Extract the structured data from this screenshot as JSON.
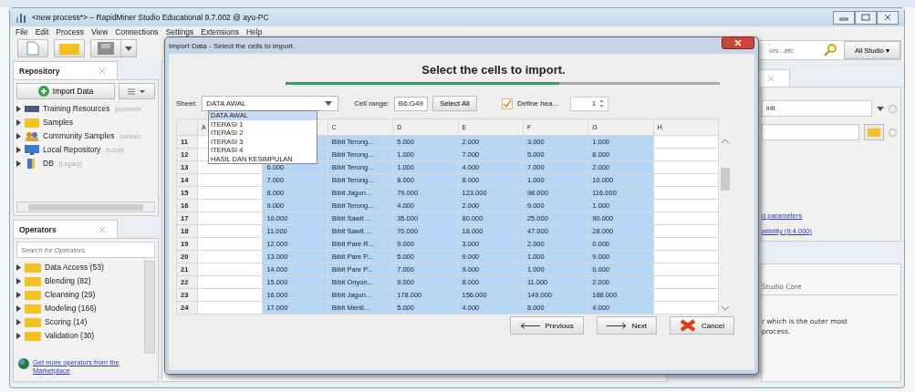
{
  "window": {
    "title": "<new process*> – RapidMiner Studio Educational 9.7.002 @ ayu-PC"
  },
  "menu": [
    "File",
    "Edit",
    "Process",
    "View",
    "Connections",
    "Settings",
    "Extensions",
    "Help"
  ],
  "repository": {
    "tab": "Repository",
    "import_button": "Import Data",
    "items": [
      {
        "label": "Training Resources",
        "note": "(connecte"
      },
      {
        "label": "Samples"
      },
      {
        "label": "Community Samples",
        "note": "(connec"
      },
      {
        "label": "Local Repository",
        "note": "(Local)"
      },
      {
        "label": "DB",
        "note": "(Legacy)"
      }
    ]
  },
  "operators": {
    "tab": "Operators",
    "search": {
      "placeholder": "Search for Operators"
    },
    "items": [
      "Data Access (53)",
      "Blending (82)",
      "Cleansing (29)",
      "Modeling (166)",
      "Scoring (14)",
      "Validation (30)"
    ],
    "marketplace_link": "Get more operators from the Marketplace"
  },
  "right_panel": {
    "search": {
      "value": "ors...etc"
    },
    "scope_button": "All Studio ▾",
    "select": "init",
    "links": [
      "d parameters",
      "atibility (9.4.000)"
    ],
    "help_title": "Studio Core",
    "help_text": [
      "r which is the outer most",
      "process."
    ]
  },
  "dialog": {
    "title": "Import Data - Select the cells to import.",
    "heading": "Select the cells to import.",
    "progress": {
      "level": 0.63
    },
    "sheet_label": "Sheet:",
    "sheet_value": "DATA AWAL",
    "sheet_options": [
      {
        "label": "DATA AWAL",
        "selected": true
      },
      {
        "label": "ITERASI 1",
        "selected": false
      },
      {
        "label": "ITERASI 2",
        "selected": false
      },
      {
        "label": "ITERASI 3",
        "selected": false
      },
      {
        "label": "ITERASI 4",
        "selected": false
      },
      {
        "label": "HASIL DAN KESIMPULAN",
        "selected": false
      }
    ],
    "cell_range_label": "Cell range:",
    "cell_range": "B6:G49",
    "select_all": "Select All",
    "define_header": {
      "label": "Define hea...",
      "checked": true
    },
    "header_row": "1",
    "columns": [
      {
        "name": "A",
        "selected": false
      },
      {
        "selected": true
      },
      {
        "name": "C",
        "selected": true
      },
      {
        "name": "D",
        "selected": true
      },
      {
        "name": "E",
        "selected": true
      },
      {
        "name": "F",
        "selected": true
      },
      {
        "name": "G",
        "selected": true
      },
      {
        "name": "H",
        "selected": false
      }
    ],
    "rows": [
      {
        "num": "11",
        "cells": [
          null,
          null,
          "Bibit Terong...",
          "5.000",
          "2.000",
          "3.000",
          "1.000",
          null
        ]
      },
      {
        "num": "12",
        "cells": [
          null,
          null,
          "Bibit Terong...",
          "1.000",
          "7.000",
          "5.000",
          "8.000",
          null
        ]
      },
      {
        "num": "13",
        "cells": [
          null,
          "6.000",
          "Bibit Terong...",
          "1.000",
          "4.000",
          "7.000",
          "2.000",
          null
        ]
      },
      {
        "num": "14",
        "cells": [
          null,
          "7.000",
          "Bibit Terong...",
          "8.000",
          "8.000",
          "1.000",
          "10.000",
          null
        ]
      },
      {
        "num": "15",
        "cells": [
          null,
          "8.000",
          "Bibit Jagun...",
          "79.000",
          "123.000",
          "98.000",
          "116.000",
          null
        ]
      },
      {
        "num": "16",
        "cells": [
          null,
          "9.000",
          "Bibit Terong...",
          "4.000",
          "2.000",
          "9.000",
          "1.000",
          null
        ]
      },
      {
        "num": "17",
        "cells": [
          null,
          "10.000",
          "Bibit Sawit ...",
          "35.000",
          "80.000",
          "25.000",
          "90.000",
          null
        ]
      },
      {
        "num": "18",
        "cells": [
          null,
          "11.000",
          "Bibit Sawit ...",
          "70.000",
          "18.000",
          "47.000",
          "28.000",
          null
        ]
      },
      {
        "num": "19",
        "cells": [
          null,
          "12.000",
          "Bibit Pare R...",
          "9.000",
          "3.000",
          "2.000",
          "0.000",
          null
        ]
      },
      {
        "num": "20",
        "cells": [
          null,
          "13.000",
          "Bibit Pare P...",
          "5.000",
          "9.000",
          "1.000",
          "9.000",
          null
        ]
      },
      {
        "num": "21",
        "cells": [
          null,
          "14.000",
          "Bibit Pare P...",
          "7.000",
          "9.000",
          "1.000",
          "0.000",
          null
        ]
      },
      {
        "num": "22",
        "cells": [
          null,
          "15.000",
          "Bibit Onyon...",
          "9.000",
          "8.000",
          "11.000",
          "2.000",
          null
        ]
      },
      {
        "num": "23",
        "cells": [
          null,
          "16.000",
          "Bibit Jagun...",
          "178.000",
          "156.000",
          "149.000",
          "188.000",
          null
        ]
      },
      {
        "num": "24",
        "cells": [
          null,
          "17.000",
          "Bibit Menti...",
          "5.000",
          "4.000",
          "8.000",
          "4.000",
          null
        ]
      }
    ],
    "buttons": {
      "previous": "Previous",
      "next": "Next",
      "cancel": "Cancel"
    }
  }
}
